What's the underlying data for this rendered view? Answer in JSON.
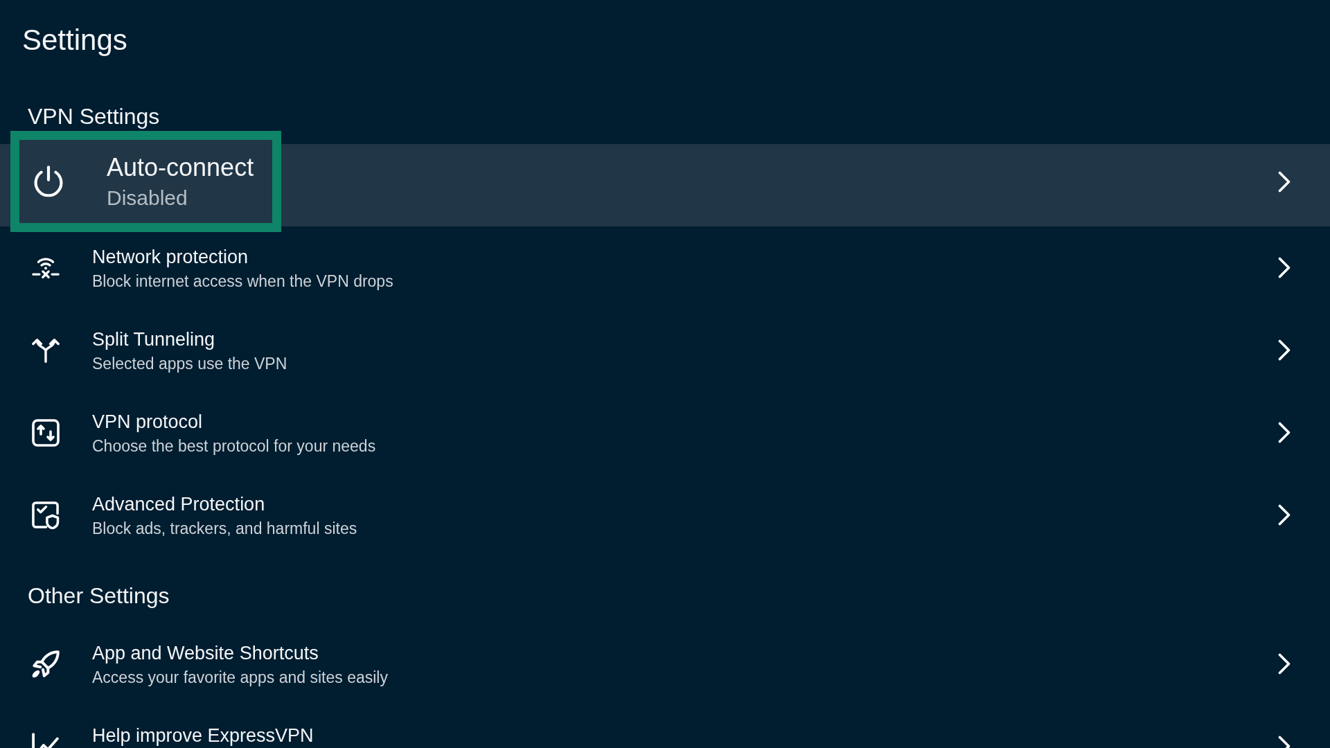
{
  "title": "Settings",
  "sections": [
    {
      "heading": "VPN Settings",
      "items": [
        {
          "kind": "power",
          "title": "Auto-connect",
          "subtitle": "Disabled",
          "selected": true
        },
        {
          "kind": "network",
          "title": "Network protection",
          "subtitle": "Block internet access when the VPN drops",
          "selected": false
        },
        {
          "kind": "split",
          "title": "Split Tunneling",
          "subtitle": "Selected apps use the VPN",
          "selected": false
        },
        {
          "kind": "protocol",
          "title": "VPN protocol",
          "subtitle": "Choose the best protocol for your needs",
          "selected": false
        },
        {
          "kind": "protection",
          "title": "Advanced Protection",
          "subtitle": "Block ads, trackers, and harmful sites",
          "selected": false
        }
      ]
    },
    {
      "heading": "Other Settings",
      "items": [
        {
          "kind": "shortcuts",
          "title": "App and Website Shortcuts",
          "subtitle": "Access your favorite apps and sites easily",
          "selected": false
        },
        {
          "kind": "analytics",
          "title": "Help improve ExpressVPN",
          "selected": false
        }
      ]
    }
  ]
}
